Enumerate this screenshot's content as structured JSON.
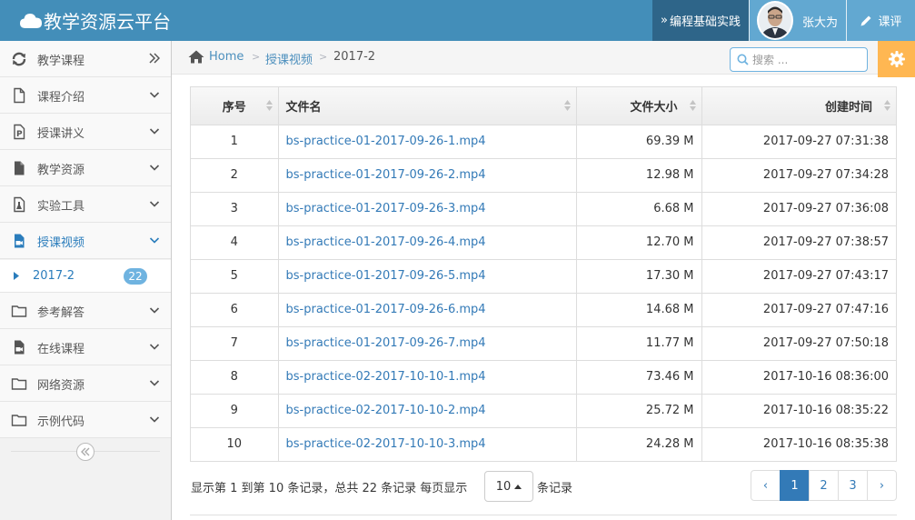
{
  "navbar": {
    "brand": "教学资源云平台",
    "course_link": "编程基础实践",
    "user_name": "张大为",
    "eval_link": "课评"
  },
  "sidebar": {
    "items": [
      {
        "label": "教学课程",
        "icon": "refresh-icon"
      },
      {
        "label": "课程介绍",
        "icon": "file-icon"
      },
      {
        "label": "授课讲义",
        "icon": "file-powerpoint-icon"
      },
      {
        "label": "教学资源",
        "icon": "file-solid-icon"
      },
      {
        "label": "实验工具",
        "icon": "flask-file-icon"
      },
      {
        "label": "授课视频",
        "icon": "video-file-icon"
      },
      {
        "label": "参考解答",
        "icon": "folder-icon"
      },
      {
        "label": "在线课程",
        "icon": "video-file-icon"
      },
      {
        "label": "网络资源",
        "icon": "folder-icon"
      },
      {
        "label": "示例代码",
        "icon": "folder-icon"
      }
    ],
    "active_sub": {
      "label": "2017-2",
      "badge": "22"
    }
  },
  "breadcrumb": {
    "home": "Home",
    "level1": "授课视频",
    "level2": "2017-2"
  },
  "search": {
    "placeholder": "搜索 ..."
  },
  "table": {
    "headers": [
      "序号",
      "文件名",
      "文件大小",
      "创建时间"
    ],
    "rows": [
      {
        "no": "1",
        "name": "bs-practice-01-2017-09-26-1.mp4",
        "size": "69.39 M",
        "time": "2017-09-27 07:31:38"
      },
      {
        "no": "2",
        "name": "bs-practice-01-2017-09-26-2.mp4",
        "size": "12.98 M",
        "time": "2017-09-27 07:34:28"
      },
      {
        "no": "3",
        "name": "bs-practice-01-2017-09-26-3.mp4",
        "size": "6.68 M",
        "time": "2017-09-27 07:36:08"
      },
      {
        "no": "4",
        "name": "bs-practice-01-2017-09-26-4.mp4",
        "size": "12.70 M",
        "time": "2017-09-27 07:38:57"
      },
      {
        "no": "5",
        "name": "bs-practice-01-2017-09-26-5.mp4",
        "size": "17.30 M",
        "time": "2017-09-27 07:43:17"
      },
      {
        "no": "6",
        "name": "bs-practice-01-2017-09-26-6.mp4",
        "size": "14.68 M",
        "time": "2017-09-27 07:47:16"
      },
      {
        "no": "7",
        "name": "bs-practice-01-2017-09-26-7.mp4",
        "size": "11.77 M",
        "time": "2017-09-27 07:50:18"
      },
      {
        "no": "8",
        "name": "bs-practice-02-2017-10-10-1.mp4",
        "size": "73.46 M",
        "time": "2017-10-16 08:36:00"
      },
      {
        "no": "9",
        "name": "bs-practice-02-2017-10-10-2.mp4",
        "size": "25.72 M",
        "time": "2017-10-16 08:35:22"
      },
      {
        "no": "10",
        "name": "bs-practice-02-2017-10-10-3.mp4",
        "size": "24.28 M",
        "time": "2017-10-16 08:35:38"
      }
    ]
  },
  "footer": {
    "summary": "显示第 1 到第 10 条记录，总共 22 条记录 每页显示",
    "page_size": "10",
    "suffix": "条记录",
    "pages": [
      "‹",
      "1",
      "2",
      "3",
      "›"
    ],
    "active_page": "1"
  },
  "colors": {
    "navbar": "#438eb9",
    "course_tab": "#2e6589",
    "accent": "#2b7dbc",
    "settings": "#ffb752",
    "active_page": "#337ab7"
  }
}
